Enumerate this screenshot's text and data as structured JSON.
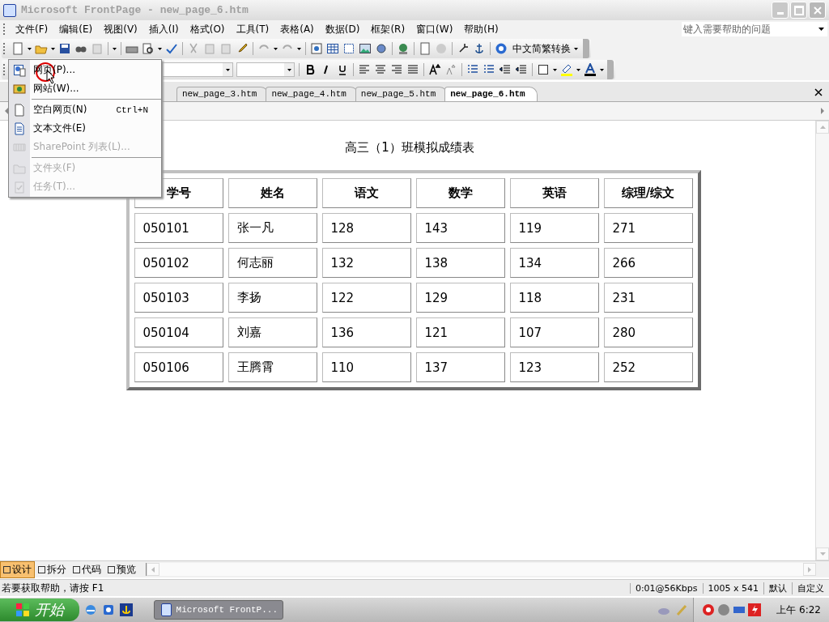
{
  "window": {
    "title": "Microsoft FrontPage - new_page_6.htm"
  },
  "menu_bar": {
    "items": [
      "文件(F)",
      "编辑(E)",
      "视图(V)",
      "插入(I)",
      "格式(O)",
      "工具(T)",
      "表格(A)",
      "数据(D)",
      "框架(R)",
      "窗口(W)",
      "帮助(H)"
    ],
    "help_search": {
      "placeholder": "键入需要帮助的问题"
    }
  },
  "standard_toolbar": {
    "converter_label": "中文简繁转换"
  },
  "new_menu": {
    "items": [
      {
        "label": "网页(P)...",
        "disabled": false,
        "separator_after": false,
        "kind": "page"
      },
      {
        "label": "网站(W)...",
        "disabled": false,
        "separator_after": true,
        "kind": "web"
      },
      {
        "label": "空白网页(N)",
        "shortcut": "Ctrl+N",
        "disabled": false,
        "separator_after": false,
        "kind": "blank"
      },
      {
        "label": "文本文件(E)",
        "disabled": false,
        "separator_after": false,
        "kind": "text"
      },
      {
        "label": "SharePoint 列表(L)...",
        "disabled": true,
        "separator_after": true,
        "kind": "list"
      },
      {
        "label": "文件夹(F)",
        "disabled": true,
        "separator_after": false,
        "kind": "folder"
      },
      {
        "label": "任务(T)...",
        "disabled": true,
        "separator_after": false,
        "kind": "task"
      }
    ]
  },
  "doc_tabs": [
    {
      "label": "new_page_3.htm",
      "selected": false
    },
    {
      "label": "new_page_4.htm",
      "selected": false
    },
    {
      "label": "new_page_5.htm",
      "selected": false
    },
    {
      "label": "new_page_6.htm",
      "selected": true
    }
  ],
  "page": {
    "heading": "高三（1）班模拟成绩表",
    "table": {
      "columns": [
        "学号",
        "姓名",
        "语文",
        "数学",
        "英语",
        "综理/综文"
      ],
      "rows": [
        [
          "050101",
          "张一凡",
          "128",
          "143",
          "119",
          "271"
        ],
        [
          "050102",
          "何志丽",
          "132",
          "138",
          "134",
          "266"
        ],
        [
          "050103",
          "李扬",
          "122",
          "129",
          "118",
          "231"
        ],
        [
          "050104",
          "刘嘉",
          "136",
          "121",
          "107",
          "280"
        ],
        [
          "050106",
          "王腾霄",
          "110",
          "137",
          "123",
          "252"
        ]
      ]
    }
  },
  "view_tabs": [
    {
      "label": "设计",
      "selected": true
    },
    {
      "label": "拆分",
      "selected": false
    },
    {
      "label": "代码",
      "selected": false
    },
    {
      "label": "预览",
      "selected": false
    }
  ],
  "status_bar": {
    "hint": "若要获取帮助，请按 F1",
    "download": "0:01@56Kbps",
    "size": "1005 x 541",
    "style": "默认",
    "mode": "自定义"
  },
  "taskbar": {
    "start": "开始",
    "task": "Microsoft FrontP...",
    "clock": "上午 6:22"
  }
}
